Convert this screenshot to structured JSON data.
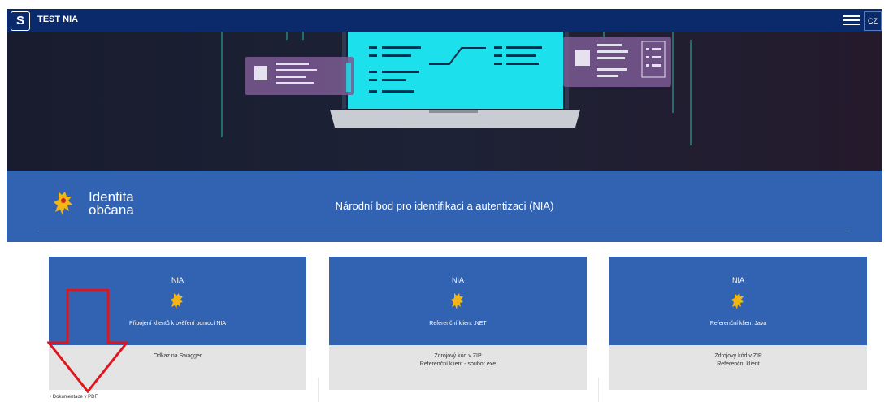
{
  "header": {
    "logo_glyph": "S",
    "title": "TEST NIA",
    "lang": "CZ",
    "menu_icon": "menu-icon"
  },
  "band": {
    "brand_line1": "Identita",
    "brand_line2": "občana",
    "title": "Národní bod pro identifikaci a autentizaci (NIA)"
  },
  "cards": [
    {
      "label": "NIA",
      "subtitle": "Připojení klientů k ověření pomocí NIA",
      "footer_line1": "Odkaz na Swagger",
      "footer_line2": ""
    },
    {
      "label": "NIA",
      "subtitle": "Referenční klient .NET",
      "footer_line1": "Zdrojový kód v ZIP",
      "footer_line2": "Referenční klient - soubor exe"
    },
    {
      "label": "NIA",
      "subtitle": "Referenční klient Java",
      "footer_line1": "Zdrojový kód v ZIP",
      "footer_line2": "Referenční klient"
    }
  ],
  "links": {
    "pdf": "• Dokumentace v PDF"
  },
  "colors": {
    "topbar": "#0a2a6b",
    "band": "#3163b2",
    "card_footer": "#e4e4e4",
    "annotation_arrow": "#e0151b",
    "lion": "#f2b516"
  }
}
